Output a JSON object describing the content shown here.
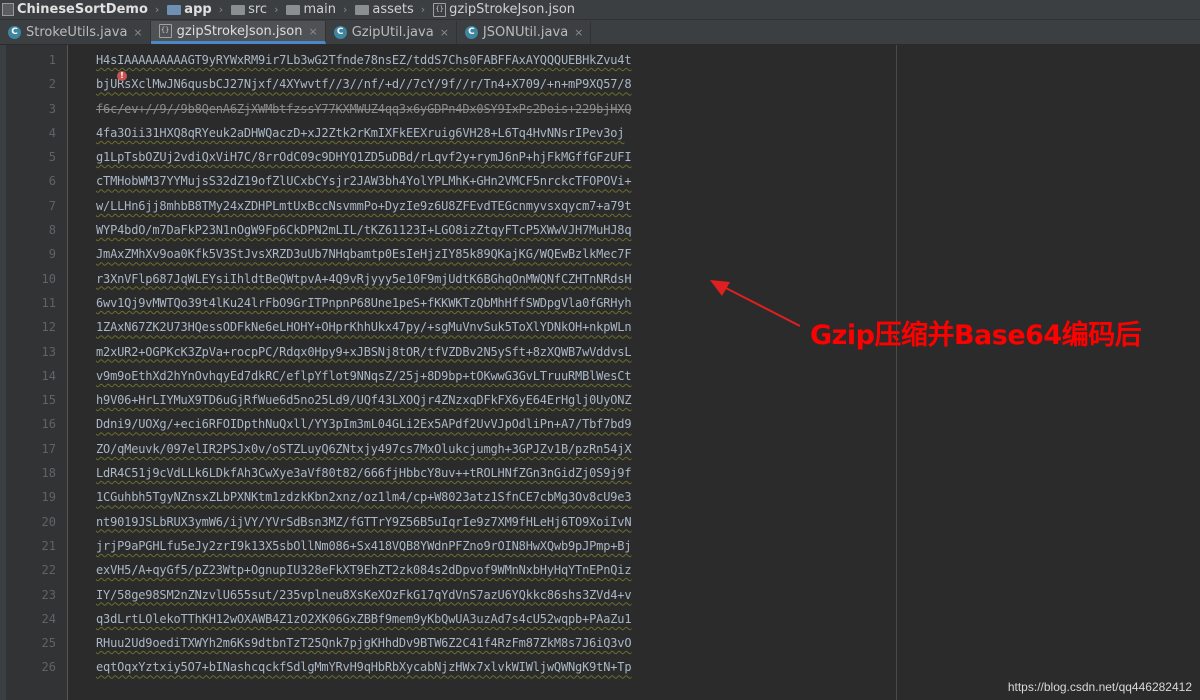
{
  "breadcrumb": {
    "items": [
      {
        "label": "ChineseSortDemo",
        "icon": "project-icon"
      },
      {
        "label": "app",
        "icon": "folder-icon"
      },
      {
        "label": "src",
        "icon": "folder-icon"
      },
      {
        "label": "main",
        "icon": "folder-icon"
      },
      {
        "label": "assets",
        "icon": "folder-icon"
      },
      {
        "label": "gzipStrokeJson.json",
        "icon": "json-file-icon"
      }
    ]
  },
  "tabs": [
    {
      "label": "StrokeUtils.java",
      "icon": "class-icon",
      "active": false
    },
    {
      "label": "gzipStrokeJson.json",
      "icon": "json-file-icon",
      "active": true
    },
    {
      "label": "GzipUtil.java",
      "icon": "class-icon",
      "active": false
    },
    {
      "label": "JSONUtil.java",
      "icon": "class-icon",
      "active": false
    }
  ],
  "tab_close_glyph": "×",
  "editor": {
    "lines": [
      {
        "n": "1",
        "text": "H4sIAAAAAAAAAGT9yRYWxRM9ir7Lb3wG2Tfnde78nsEZ/tddS7Chs0FABFFAxAYQQQUEBHkZvu4t"
      },
      {
        "n": "2",
        "text": "bjURsXclMwJN6qusbCJ27Njxf/4XYwvtf//3//nf/+d//7cY/9f//r/Tn4+X709/+n+mP9XQ57/8"
      },
      {
        "n": "3",
        "text": "f6c/ev+//9//9b8QenA6ZjXWMbtfzssY77KXMWUZ4qq3x6yGDPn4Dx0SY9IxPs2Dois+229bjHXQ"
      },
      {
        "n": "4",
        "text": "4fa3Oii31HXQ8qRYeuk2aDHWQaczD+xJ2Ztk2rKmIXFkEEXruig6VH28+L6Tq4HvNNsrIPev3oj"
      },
      {
        "n": "5",
        "text": "g1LpTsbOZUj2vdiQxViH7C/8rrOdC09c9DHYQ1ZD5uDBd/rLqvf2y+rymJ6nP+hjFkMGffGFzUFI"
      },
      {
        "n": "6",
        "text": "cTMHobWM37YYMujsS32dZ19ofZlUCxbCYsjr2JAW3bh4YolYPLMhK+GHn2VMCF5nrckcTFOPOVi+"
      },
      {
        "n": "7",
        "text": "w/LLHn6jj8mhbB8TMy24xZDHPLmtUxBccNsvmmPo+DyzIe9z6U8ZFEvdTEGcnmyvsxqycm7+a79t"
      },
      {
        "n": "8",
        "text": "WYP4bdO/m7DaFkP23N1nOgW9Fp6CkDPN2mLIL/tKZ61123I+LGO8izZtqyFTcP5XWwVJH7MuHJ8q"
      },
      {
        "n": "9",
        "text": "JmAxZMhXv9oa0Kfk5V3StJvsXRZD3uUb7NHqbamtp0EsIeHjzIY85k89QKajKG/WQEwBzlkMec7F"
      },
      {
        "n": "10",
        "text": "r3XnVFlp687JqWLEYsiIhldtBeQWtpvA+4Q9vRjyyy5e10F9mjUdtK6BGhqOnMWQNfCZHTnNRdsH"
      },
      {
        "n": "11",
        "text": "6wv1Qj9vMWTQo39t4lKu24lrFbO9GrITPnpnP68Une1peS+fKKWKTzQbMhHffSWDpgVla0fGRHyh"
      },
      {
        "n": "12",
        "text": "1ZAxN67ZK2U73HQessODFkNe6eLHOHY+OHprKhhUkx47py/+sgMuVnvSuk5ToXlYDNkOH+nkpWLn"
      },
      {
        "n": "13",
        "text": "m2xUR2+OGPKcK3ZpVa+rocpPC/Rdqx0Hpy9+xJBSNj8tOR/tfVZDBv2N5ySft+8zXQWB7wVddvsL"
      },
      {
        "n": "14",
        "text": "v9m9oEthXd2hYnOvhqyEd7dkRC/eflpYflot9NNqsZ/25j+8D9bp+tOKwwG3GvLTruuRMBlWesCt"
      },
      {
        "n": "15",
        "text": "h9V06+HrLIYMuX9TD6uGjRfWue6d5no25Ld9/UQf43LXOQjr4ZNzxqDFkFX6yE64ErHglj0UyONZ"
      },
      {
        "n": "16",
        "text": "Ddni9/UOXg/+eci6RFOIDpthNuQxll/YY3pIm3mL04GLi2Ex5APdf2UvVJpOdliPn+A7/Tbf7bd9"
      },
      {
        "n": "17",
        "text": "ZO/qMeuvk/097elIR2PSJx0v/oSTZLuyQ6ZNtxjy497cs7MxOlukcjumgh+3GPJZv1B/pzRn54jX"
      },
      {
        "n": "18",
        "text": "LdR4C51j9cVdLLk6LDkfAh3CwXye3aVf80t82/666fjHbbcY8uv++tROLHNfZGn3nGidZj0S9j9f"
      },
      {
        "n": "19",
        "text": "1CGuhbh5TgyNZnsxZLbPXNKtm1zdzkKbn2xnz/oz1lm4/cp+W8023atz1SfnCE7cbMg3Ov8cU9e3"
      },
      {
        "n": "20",
        "text": "nt9019JSLbRUX3ymW6/ijVY/YVrSdBsn3MZ/fGTTrY9Z56B5uIqrIe9z7XM9fHLeHj6TO9XoiIvN"
      },
      {
        "n": "21",
        "text": "jrjP9aPGHLfu5eJy2zrI9k13X5sbOllNm086+Sx418VQB8YWdnPFZno9rOIN8HwXQwb9pJPmp+Bj"
      },
      {
        "n": "22",
        "text": "exVH5/A+qyGf5/pZ23Wtp+OgnupIU328eFkXT9EhZT2zk084s2dDpvof9WMnNxbHyHqYTnEPnQiz"
      },
      {
        "n": "23",
        "text": "IY/58ge98SM2nZNzvlU655sut/235vplneu8XsKeXOzFkG17qYdVnS7azU6YQkkc86shs3ZVd4+v"
      },
      {
        "n": "24",
        "text": "q3dLrtLOlekoTThKH12wOXAWB4Z1zO2XK06GxZBBf9mem9yKbQwUA3uzAd7s4cU52wqpb+PAaZu1"
      },
      {
        "n": "25",
        "text": "RHuu2Ud9oediTXWYh2m6Ks9dtbnTzT25Qnk7pjgKHhdDv9BTW6Z2C41f4RzFm87ZkM8s7J6iQ3vO"
      },
      {
        "n": "26",
        "text": "eqtOqxYztxiy5O7+bINashcqckfSdlgMmYRvH9qHbRbXycabNjzHWx7xlvkWIWljwQWNgK9tN+Tp"
      }
    ]
  },
  "annotation": {
    "text": "Gzip压缩并Base64编码后",
    "color": "#ff0000"
  },
  "watermark": "https://blog.csdn.net/qq446282412",
  "colors": {
    "background": "#2b2b2b",
    "gutter": "#313335",
    "code": "#a9b7c6",
    "tab_accent": "#4a88c7"
  }
}
